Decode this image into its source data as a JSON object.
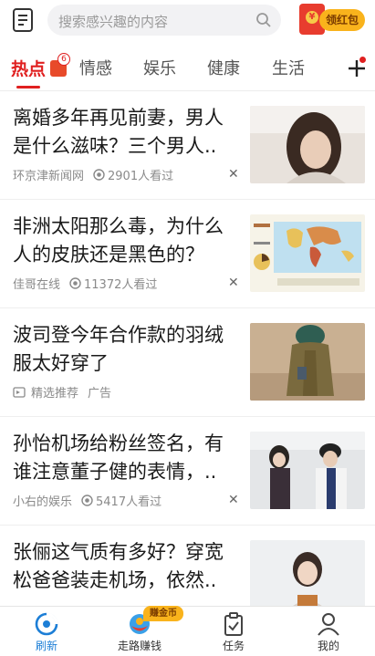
{
  "header": {
    "search_placeholder": "搜索感兴趣的内容",
    "red_packet_label": "领红包",
    "red_packet_coin": "¥"
  },
  "tabs": [
    {
      "label": "热点",
      "active": true,
      "badge": "6"
    },
    {
      "label": "情感"
    },
    {
      "label": "娱乐"
    },
    {
      "label": "健康"
    },
    {
      "label": "生活"
    }
  ],
  "feed": [
    {
      "title": "离婚多年再见前妻，男人是什么滋味？三个男人..",
      "source": "环京津新闻网",
      "views": "2901人看过",
      "thumb": "woman-portrait"
    },
    {
      "title": "非洲太阳那么毒，为什么人的皮肤还是黑色的？",
      "source": "佳哥在线",
      "views": "11372人看过",
      "thumb": "world-map"
    },
    {
      "title": "波司登今年合作款的羽绒服太好穿了",
      "source": "精选推荐",
      "tag": "广告",
      "thumb": "down-jacket"
    },
    {
      "title": "孙怡机场给粉丝签名，有谁注意董子健的表情，..",
      "source": "小右的娱乐",
      "views": "5417人看过",
      "thumb": "airport-couple"
    },
    {
      "title": "张俪这气质有多好？穿宽松爸爸装走机场，依然..",
      "source": "",
      "views": "",
      "thumb": "woman-jacket"
    }
  ],
  "close_mark": "✕",
  "bottom_nav": [
    {
      "label": "刷新",
      "active": true
    },
    {
      "label": "走路赚钱",
      "tag": "赚金币"
    },
    {
      "label": "任务"
    },
    {
      "label": "我的"
    }
  ],
  "colors": {
    "accent_red": "#e02020",
    "nav_active_blue": "#1c7ed6",
    "gold": "#f9b31c"
  }
}
